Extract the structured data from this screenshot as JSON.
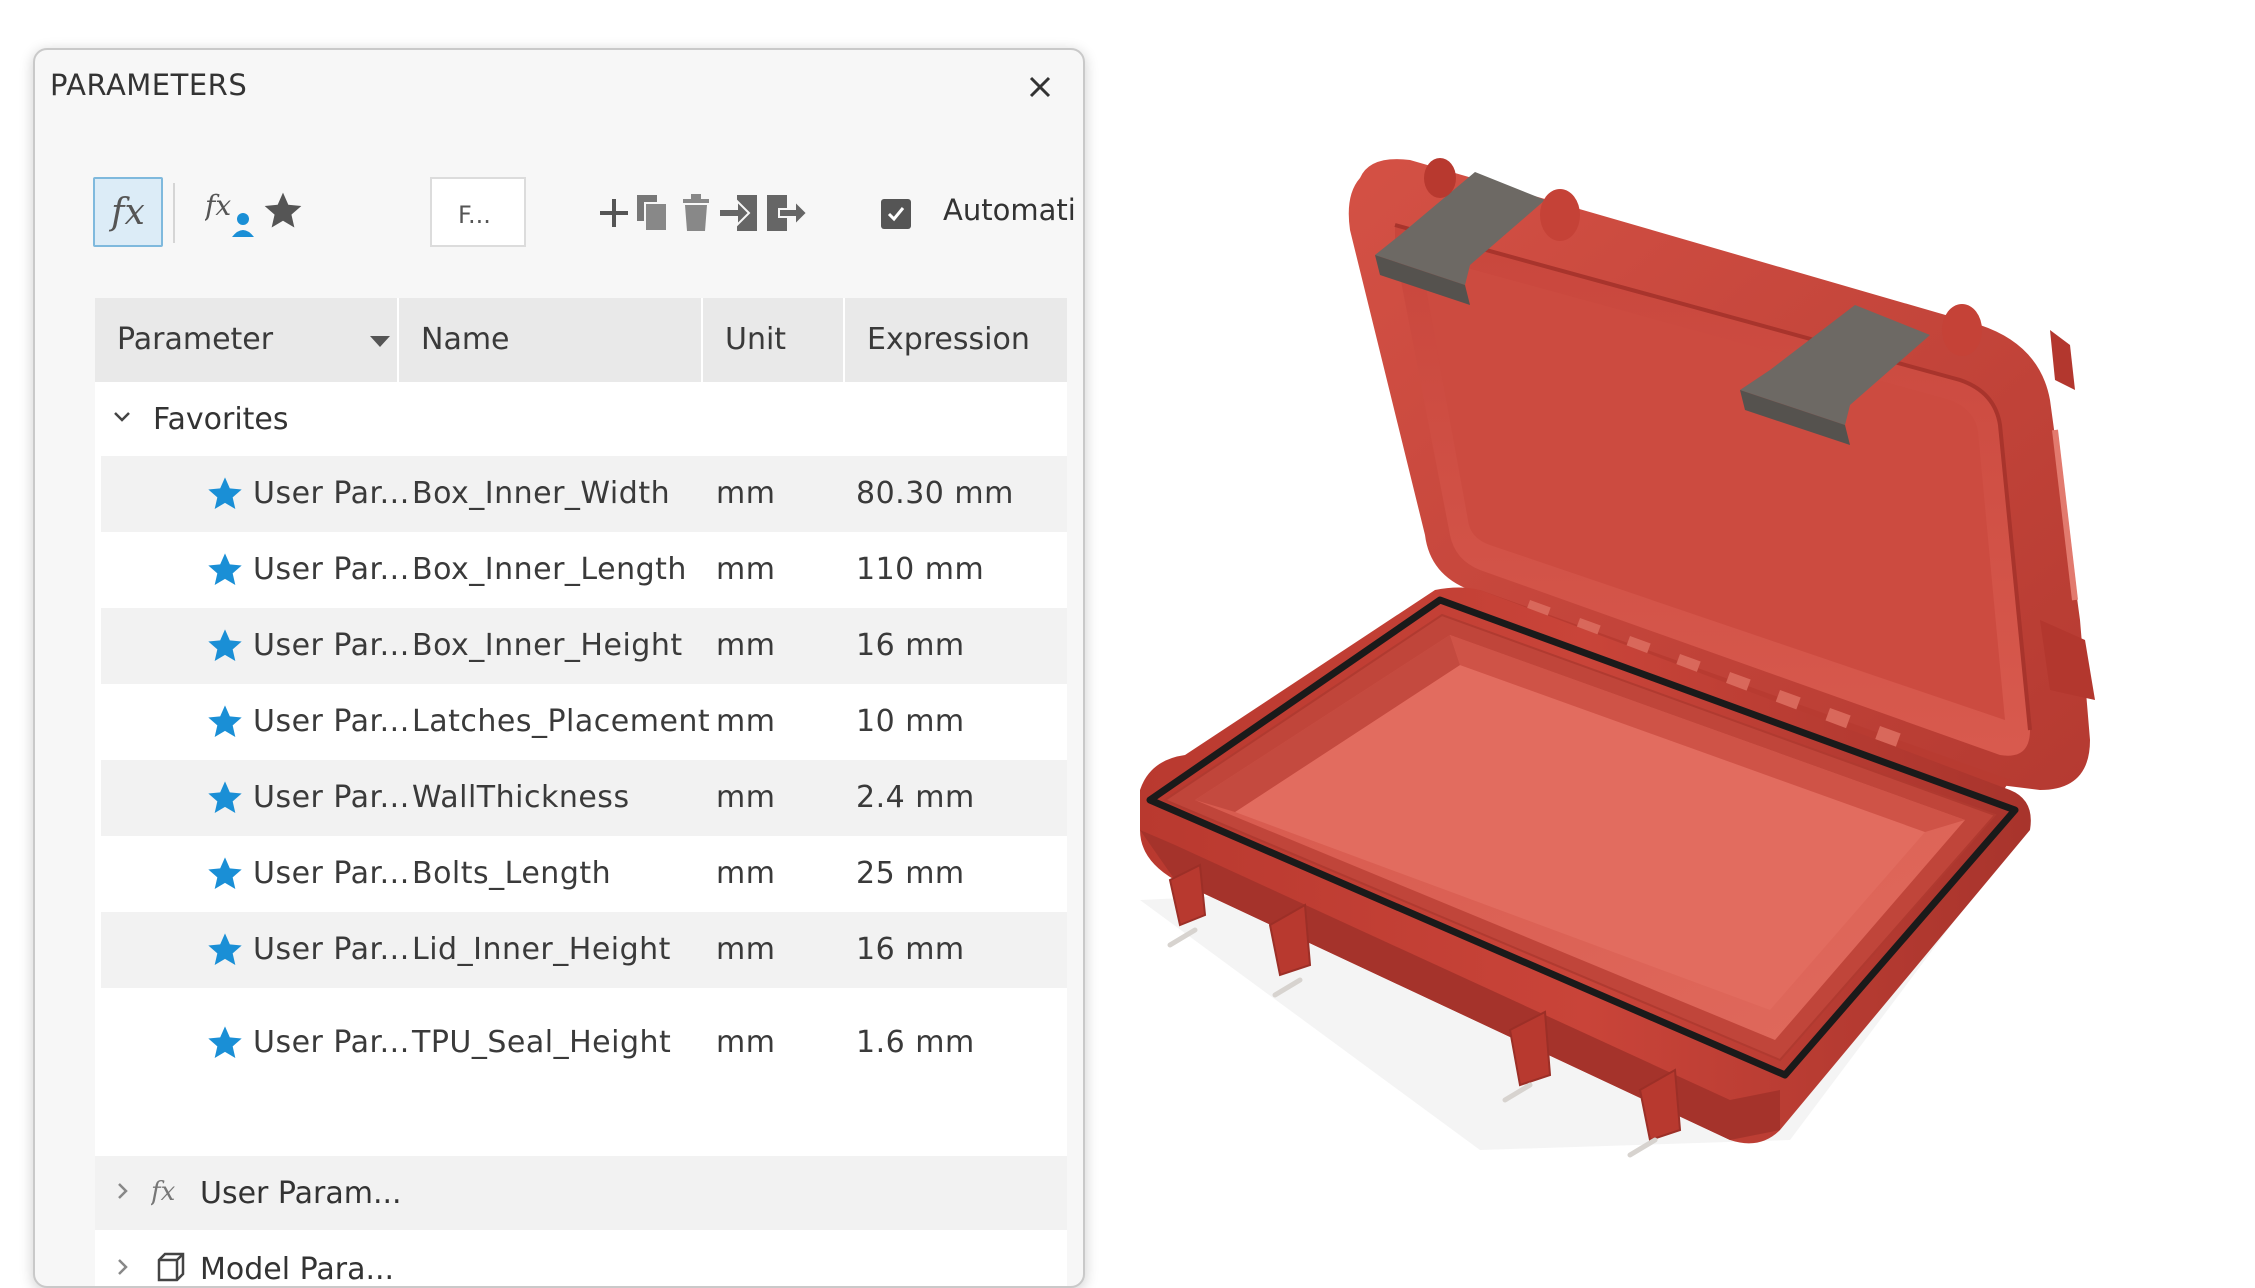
{
  "dialog": {
    "title": "PARAMETERS",
    "close_icon": "close-icon"
  },
  "toolbar": {
    "fx_icon": "function-icon",
    "user_fx_icon": "user-function-icon",
    "favorites_icon": "star-icon",
    "filter_placeholder": "F...",
    "add_icon": "plus-icon",
    "copy_icon": "copy-icon",
    "delete_icon": "trash-icon",
    "import_icon": "import-icon",
    "export_icon": "export-icon",
    "auto_checked": true,
    "auto_label": "Automati"
  },
  "table": {
    "columns": [
      "Parameter",
      "Name",
      "Unit",
      "Expression"
    ],
    "favorites_label": "Favorites",
    "rows": [
      {
        "parameter": "User Par...",
        "name": "Box_Inner_Width",
        "unit": "mm",
        "expression": "80.30 mm"
      },
      {
        "parameter": "User Par...",
        "name": "Box_Inner_Length",
        "unit": "mm",
        "expression": "110 mm"
      },
      {
        "parameter": "User Par...",
        "name": "Box_Inner_Height",
        "unit": "mm",
        "expression": "16 mm"
      },
      {
        "parameter": "User Par...",
        "name": "Latches_Placement",
        "unit": "mm",
        "expression": "10 mm"
      },
      {
        "parameter": "User Par...",
        "name": "WallThickness",
        "unit": "mm",
        "expression": "2.4 mm"
      },
      {
        "parameter": "User Par...",
        "name": "Bolts_Length",
        "unit": "mm",
        "expression": "25 mm"
      },
      {
        "parameter": "User Par...",
        "name": "Lid_Inner_Height",
        "unit": "mm",
        "expression": "16 mm"
      },
      {
        "parameter": "User Par...",
        "name": "TPU_Seal_Height",
        "unit": "mm",
        "expression": "1.6 mm"
      }
    ],
    "user_params_label": "User Param...",
    "model_params_label": "Model Para..."
  },
  "colors": {
    "accent": "#1a8fd6",
    "case_red": "#c9453b",
    "latch_grey": "#6b6762"
  }
}
